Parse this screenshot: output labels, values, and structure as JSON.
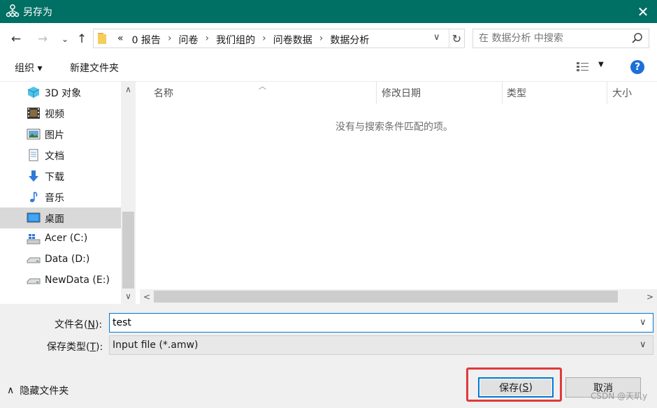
{
  "window": {
    "title": "另存为"
  },
  "address": {
    "overflow": "«",
    "crumbs": [
      "0 报告",
      "问卷",
      "我们组的",
      "问卷数据",
      "数据分析"
    ],
    "separator": "›"
  },
  "search": {
    "placeholder": "在 数据分析 中搜索"
  },
  "toolbar": {
    "organize": "组织 ▾",
    "new_folder": "新建文件夹",
    "help": "?"
  },
  "nav": {
    "items": [
      {
        "label": "3D 对象",
        "icon": "3d-objects-icon"
      },
      {
        "label": "视频",
        "icon": "video-icon"
      },
      {
        "label": "图片",
        "icon": "pictures-icon"
      },
      {
        "label": "文档",
        "icon": "documents-icon"
      },
      {
        "label": "下载",
        "icon": "download-icon"
      },
      {
        "label": "音乐",
        "icon": "music-icon"
      },
      {
        "label": "桌面",
        "icon": "desktop-icon",
        "selected": true
      },
      {
        "label": "Acer (C:)",
        "icon": "windows-drive-icon"
      },
      {
        "label": "Data (D:)",
        "icon": "drive-icon"
      },
      {
        "label": "NewData (E:)",
        "icon": "drive-icon"
      }
    ]
  },
  "columns": [
    "名称",
    "修改日期",
    "类型",
    "大小"
  ],
  "empty_message": "没有与搜索条件匹配的项。",
  "form": {
    "filename_label_pre": "文件名(",
    "filename_key": "N",
    "filename_label_post": "):",
    "filename_value": "test",
    "filetype_label_pre": "保存类型(",
    "filetype_key": "T",
    "filetype_label_post": "):",
    "filetype_value": "Input file (*.amw)"
  },
  "footer": {
    "hide_folders": "隐藏文件夹",
    "save_pre": "保存(",
    "save_key": "S",
    "save_post": ")",
    "cancel": "取消",
    "watermark": "CSDN @天玑y"
  },
  "colors": {
    "titlebar": "#006f64",
    "accent": "#0078d7",
    "highlight_box": "#e03a3a"
  }
}
